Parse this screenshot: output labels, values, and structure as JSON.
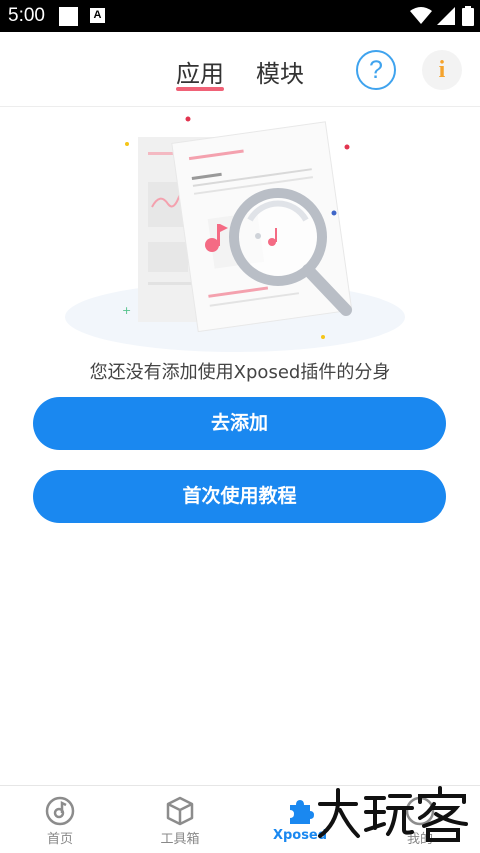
{
  "status_bar": {
    "time": "5:00",
    "notification_icon": "A"
  },
  "header": {
    "tabs": [
      {
        "label": "应用",
        "active": true
      },
      {
        "label": "模块",
        "active": false
      }
    ],
    "help_icon": "question-circle-icon",
    "info_icon": "info-icon",
    "help_glyph": "?",
    "info_glyph": "i"
  },
  "main": {
    "empty_message": "您还没有添加使用Xposed插件的分身",
    "add_button": "去添加",
    "tutorial_button": "首次使用教程"
  },
  "bottom_nav": [
    {
      "label": "首页",
      "icon": "music-disc-icon"
    },
    {
      "label": "工具箱",
      "icon": "box-icon"
    },
    {
      "label": "Xposed",
      "icon": "puzzle-icon",
      "active": true
    },
    {
      "label": "我的",
      "icon": "profile-icon"
    }
  ],
  "watermark": "大玩客",
  "colors": {
    "accent": "#1a88f0",
    "tab_underline": "#f06277",
    "help": "#3fa3ee",
    "info": "#f5a32d"
  }
}
